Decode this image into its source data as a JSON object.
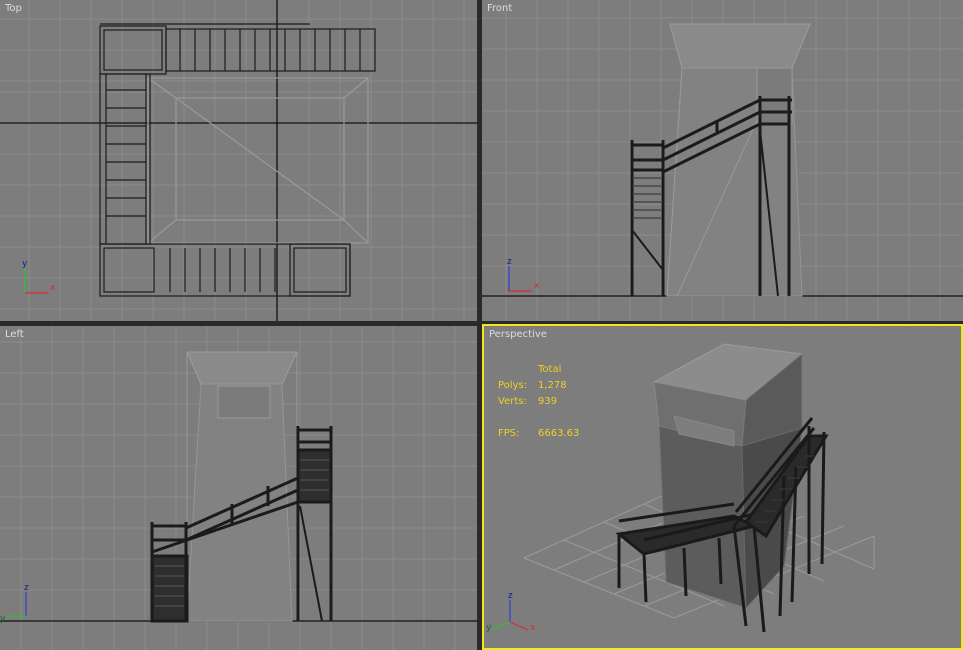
{
  "viewports": {
    "top": {
      "label": "Top"
    },
    "front": {
      "label": "Front"
    },
    "left": {
      "label": "Left"
    },
    "perspective": {
      "label": "Perspective",
      "stats": {
        "header": "Total",
        "polys_label": "Polys:",
        "polys_value": "1,278",
        "verts_label": "Verts:",
        "verts_value": "939",
        "fps_label": "FPS:",
        "fps_value": "6663.63"
      }
    }
  },
  "axis": {
    "x": "x",
    "y": "y",
    "z": "z"
  },
  "colors": {
    "viewport_bg": "#7d7d7d",
    "grid": "#8c8c8c",
    "active_border": "#f0e81c",
    "stats_text": "#f0d020",
    "axis_x": "#d03030",
    "axis_y": "#30c030",
    "axis_z": "#3040d0"
  }
}
